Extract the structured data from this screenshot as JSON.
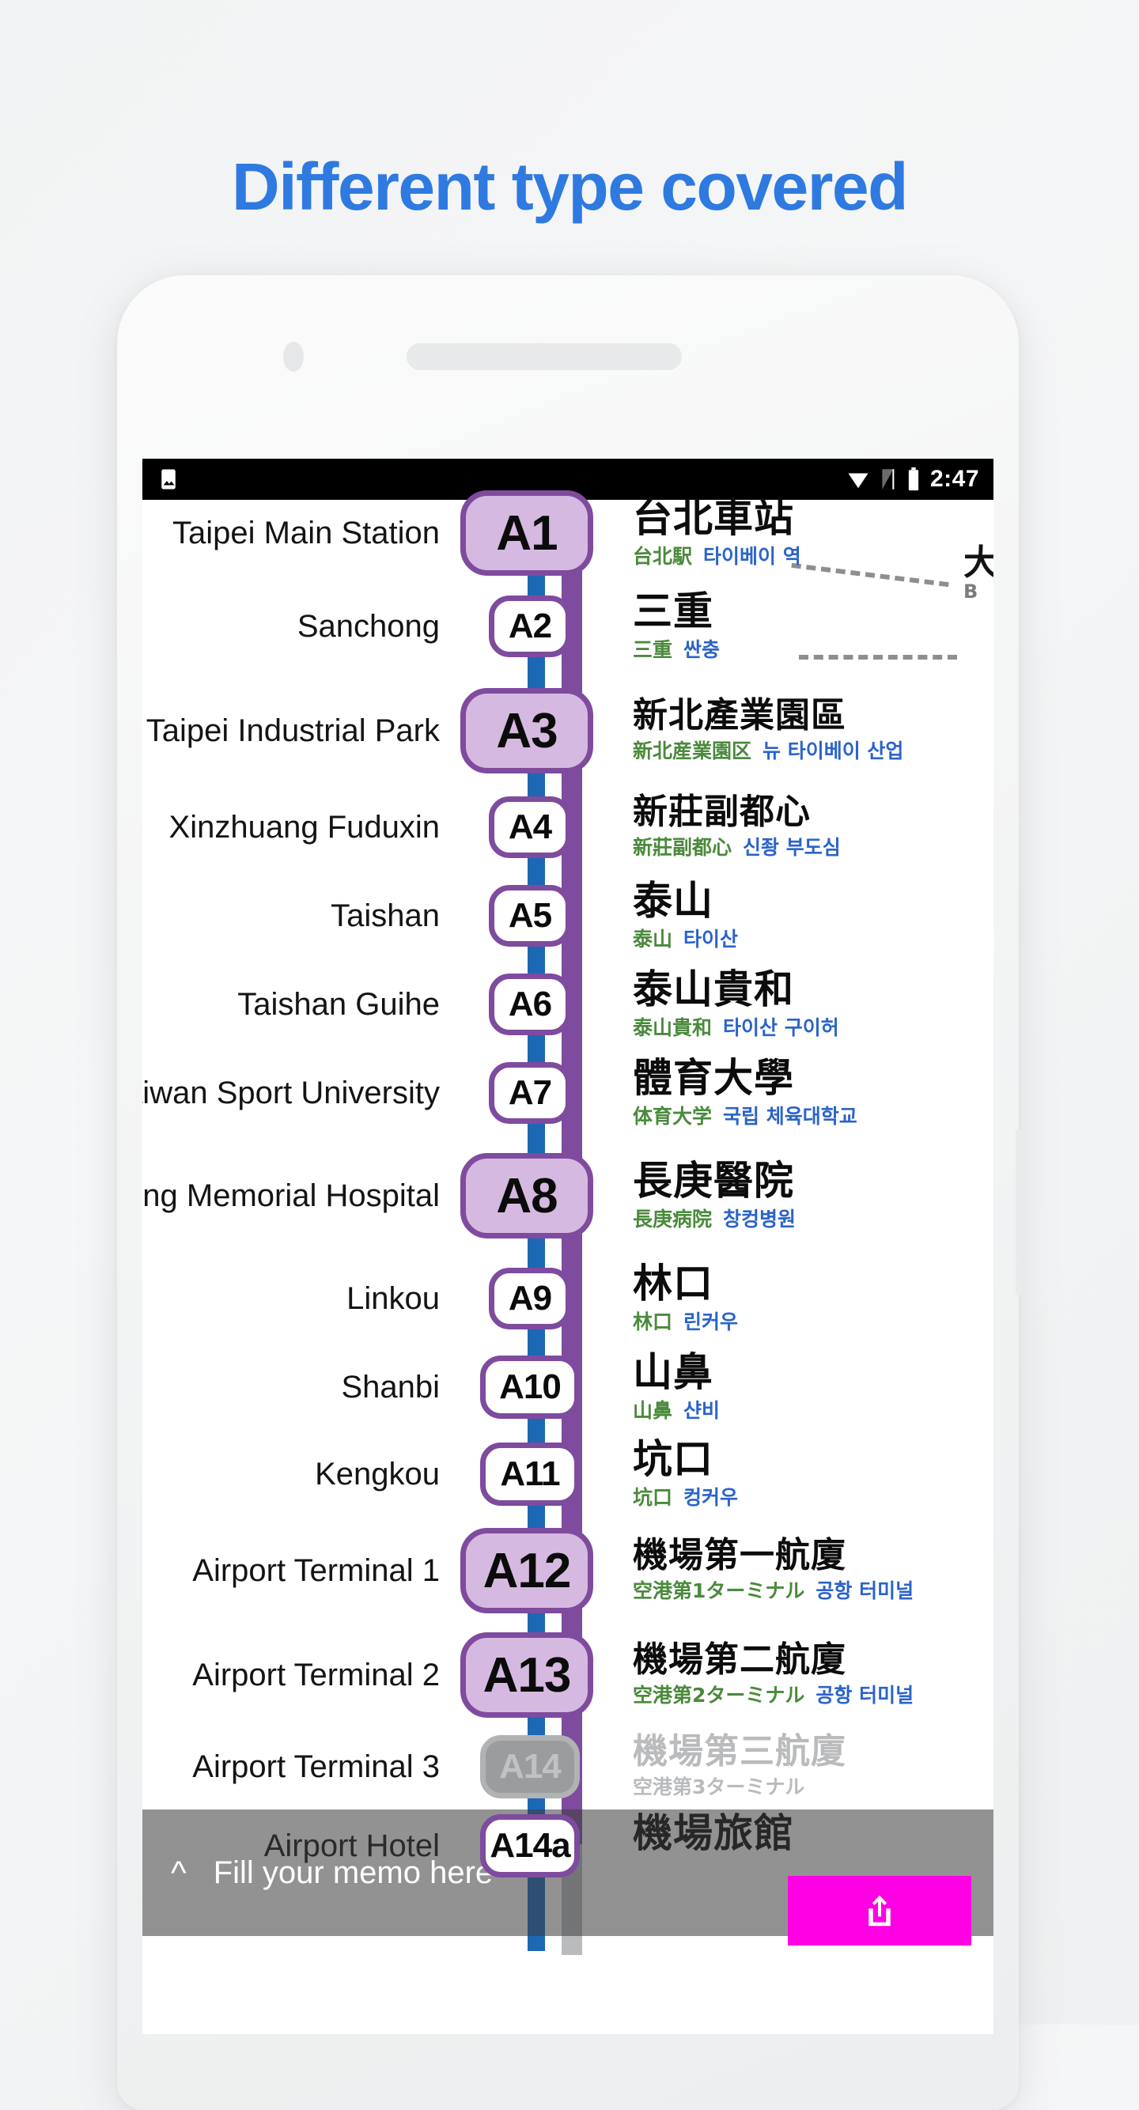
{
  "headline": "Different type covered",
  "device": {
    "camera_icon": "camera-dot",
    "speaker_icon": "speaker-grille"
  },
  "status_bar": {
    "photo_icon": "image-icon",
    "wifi_icon": "wifi-icon",
    "signal_icon": "signal-icon",
    "battery_icon": "battery-icon",
    "clock": "2:47"
  },
  "colors": {
    "headline_blue": "#2e7ae0",
    "express_purple": "#7e4b9e",
    "commuter_blue": "#1c68b3",
    "express_station_fill": "#d6b9e0",
    "share_magenta": "#ff00e4",
    "japanese_green": "#4a8a3c",
    "korean_blue": "#2b63c9",
    "dim_gray": "#9a9c9e"
  },
  "route": {
    "line_name_express": "express-line",
    "line_name_commuter": "commuter-line",
    "branch_hint": {
      "zh": "大",
      "latin": "B"
    },
    "stations": [
      {
        "code": "A1",
        "en": "Taipei Main Station",
        "zh": "台北車站",
        "ja": "台北駅",
        "ko": "타이베이 역",
        "type": "express"
      },
      {
        "code": "A2",
        "en": "Sanchong",
        "zh": "三重",
        "ja": "三重",
        "ko": "싼충",
        "type": "commuter"
      },
      {
        "code": "A3",
        "en": "New Taipei Industrial Park",
        "zh": "新北產業園區",
        "ja": "新北産業園区",
        "ko": "뉴 타이베이 산업",
        "type": "express"
      },
      {
        "code": "A4",
        "en": "Xinzhuang Fuduxin",
        "zh": "新莊副都心",
        "ja": "新莊副都心",
        "ko": "신좡 부도심",
        "type": "commuter"
      },
      {
        "code": "A5",
        "en": "Taishan",
        "zh": "泰山",
        "ja": "泰山",
        "ko": "타이산",
        "type": "commuter"
      },
      {
        "code": "A6",
        "en": "Taishan Guihe",
        "zh": "泰山貴和",
        "ja": "泰山貴和",
        "ko": "타이산 구이허",
        "type": "commuter"
      },
      {
        "code": "A7",
        "en": "Taiwan Sport University",
        "zh": "體育大學",
        "ja": "体育大学",
        "ko": "국립 체육대학교",
        "type": "commuter"
      },
      {
        "code": "A8",
        "en": "Chang Gung Memorial Hospital",
        "zh": "長庚醫院",
        "ja": "長庚病院",
        "ko": "창컹병원",
        "type": "express"
      },
      {
        "code": "A9",
        "en": "Linkou",
        "zh": "林口",
        "ja": "林口",
        "ko": "린커우",
        "type": "commuter"
      },
      {
        "code": "A10",
        "en": "Shanbi",
        "zh": "山鼻",
        "ja": "山鼻",
        "ko": "샨비",
        "type": "commuter"
      },
      {
        "code": "A11",
        "en": "Kengkou",
        "zh": "坑口",
        "ja": "坑口",
        "ko": "컹커우",
        "type": "commuter"
      },
      {
        "code": "A12",
        "en": "Airport Terminal 1",
        "zh": "機場第一航廈",
        "ja": "空港第1ターミナル",
        "ko": "공항 터미널",
        "type": "express"
      },
      {
        "code": "A13",
        "en": "Airport Terminal 2",
        "zh": "機場第二航廈",
        "ja": "空港第2ターミナル",
        "ko": "공항 터미널",
        "type": "express"
      },
      {
        "code": "A14",
        "en": "Airport Terminal 3",
        "zh": "機場第三航廈",
        "ja": "空港第3ターミナル",
        "ko": "",
        "type": "dim"
      },
      {
        "code": "A14a",
        "en": "Airport Hotel",
        "zh": "機場旅館",
        "ja": "",
        "ko": "",
        "type": "commuter"
      }
    ]
  },
  "memo_bar": {
    "expand_icon": "chevron-up-icon",
    "placeholder": "Fill your memo here",
    "share_icon": "share-icon"
  }
}
